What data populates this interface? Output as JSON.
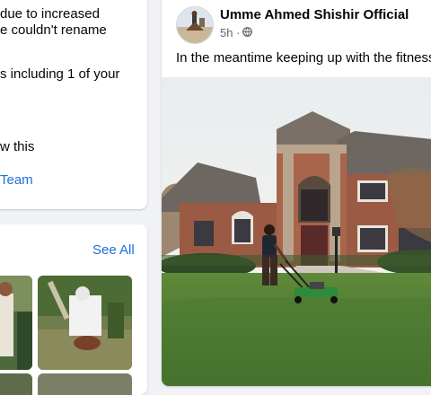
{
  "notice": {
    "lines": [
      "due to increased",
      "e couldn't rename",
      "s including 1 of your",
      "w this"
    ],
    "link": "Team"
  },
  "photos": {
    "see_all": "See All"
  },
  "post": {
    "author": "Umme Ahmed Shishir Official",
    "time": "5h ·",
    "audience_icon": "globe-icon",
    "text": "In the meantime keeping up with the fitness"
  },
  "colors": {
    "link": "#216fdb",
    "background": "#f0f2f5",
    "card": "#ffffff",
    "secondary_text": "#65676b"
  }
}
